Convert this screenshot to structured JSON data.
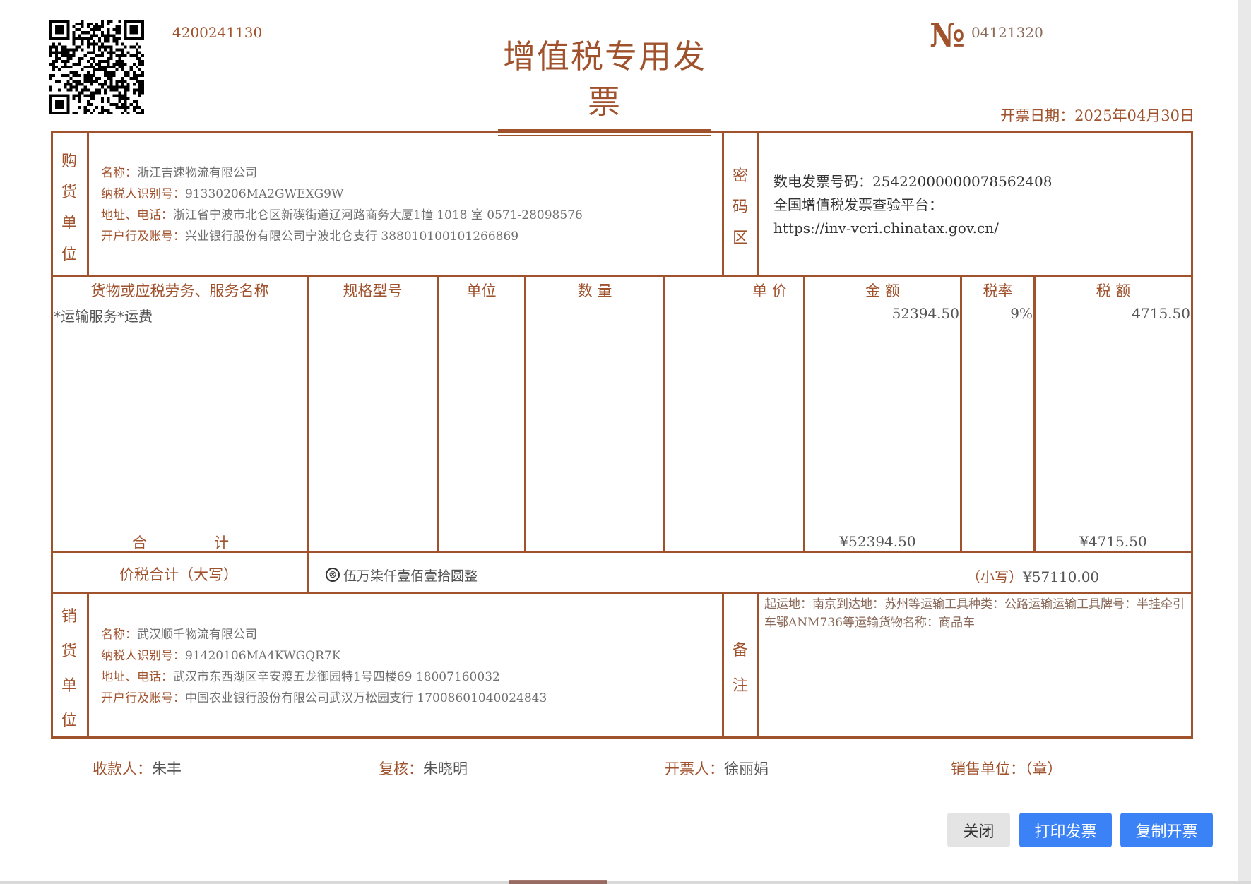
{
  "header": {
    "invoice_code": "4200241130",
    "title": "增值税专用发票",
    "no_symbol": "№",
    "invoice_number": "04121320",
    "issue_date_label": "开票日期：",
    "issue_date": "2025年04月30日"
  },
  "buyer": {
    "label_chars": [
      "购",
      "货",
      "单",
      "位"
    ],
    "name_label": "名称：",
    "name": "浙江吉速物流有限公司",
    "tax_id_label": "纳税人识别号：",
    "tax_id": "91330206MA2GWEXG9W",
    "address_label": "地址、电话：",
    "address": "浙江省宁波市北仑区新碶街道辽河路商务大厦1幢 1018 室 0571-28098576",
    "bank_label": "开户行及账号：",
    "bank": "兴业银行股份有限公司宁波北仑支行 388010100101266869"
  },
  "cipher": {
    "label_chars": [
      "密",
      "码",
      "区"
    ],
    "line1": "数电发票号码：25422000000078562408",
    "line2": "全国增值税发票查验平台：",
    "line3": "https://inv-veri.chinatax.gov.cn/"
  },
  "columns": {
    "name": "货物或应税劳务、服务名称",
    "spec": "规格型号",
    "unit": "单位",
    "qty": "数 量",
    "price": "单 价",
    "amount": "金 额",
    "rate": "税率",
    "tax": "税 额"
  },
  "items": [
    {
      "name": "*运输服务*运费",
      "amount": "52394.50",
      "rate": "9%",
      "tax": "4715.50"
    }
  ],
  "totals": {
    "label_he": "合",
    "label_ji": "计",
    "amount": "¥52394.50",
    "tax": "¥4715.50"
  },
  "sum": {
    "label": "价税合计（大写）",
    "icon": "⊗",
    "words": "伍万柒仟壹佰壹拾圆整",
    "small_label": "（小写）",
    "small_value": "¥57110.00"
  },
  "seller": {
    "label_chars": [
      "销",
      "货",
      "单",
      "位"
    ],
    "name_label": "名称：",
    "name": "武汉顺千物流有限公司",
    "tax_id_label": "纳税人识别号：",
    "tax_id": "91420106MA4KWGQR7K",
    "address_label": "地址、电话：",
    "address": "武汉市东西湖区辛安渡五龙御园特1号四楼69 18007160032",
    "bank_label": "开户行及账号：",
    "bank": "中国农业银行股份有限公司武汉万松园支行 17008601040024843"
  },
  "remark": {
    "label_chars": [
      "备",
      "注"
    ],
    "text": "起运地：南京到达地：苏州等运输工具种类：公路运输运输工具牌号：半挂牵引车鄂ANM736等运输货物名称：商品车"
  },
  "signatures": {
    "payee_label": "收款人：",
    "payee": "朱丰",
    "reviewer_label": "复核：",
    "reviewer": "朱晓明",
    "issuer_label": "开票人：",
    "issuer": "徐丽娟",
    "seller_label": "销售单位：（章）"
  },
  "buttons": {
    "close": "关闭",
    "print": "打印发票",
    "copy": "复制开票"
  },
  "colors": {
    "accent": "#a0522d",
    "button_primary": "#3b82f6",
    "button_secondary": "#e4e4e4"
  },
  "icons": {
    "qr": "qr-code-icon",
    "sum": "circle-x-icon"
  }
}
